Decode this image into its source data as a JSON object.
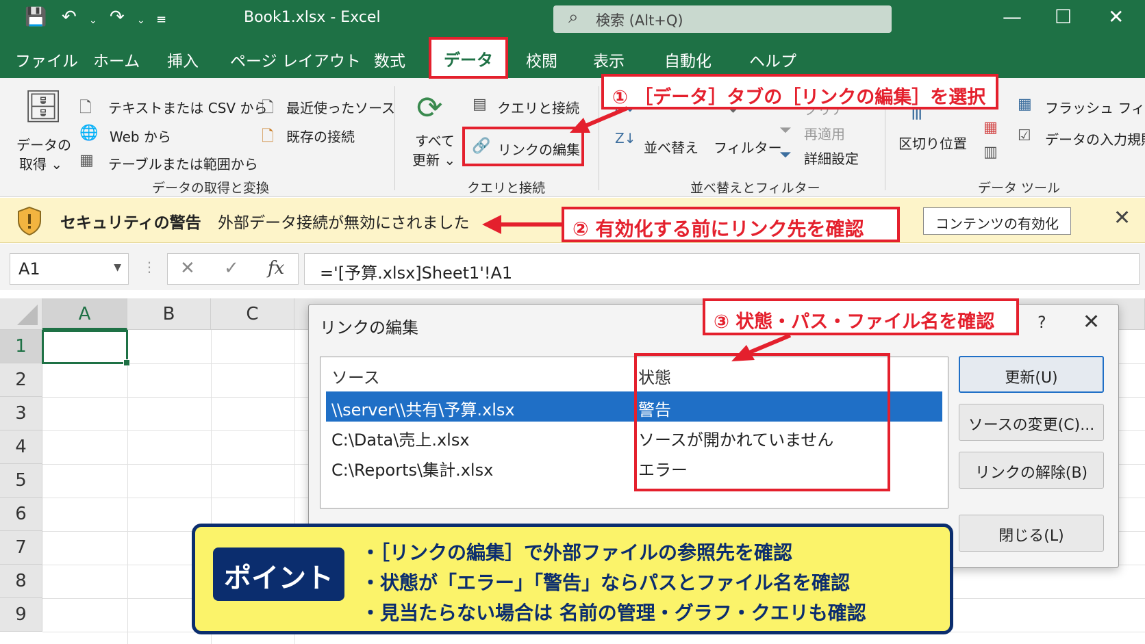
{
  "window": {
    "title": "Book1.xlsx - Excel",
    "search_placeholder": "検索 (Alt+Q)"
  },
  "tabs": [
    "ファイル",
    "ホーム",
    "挿入",
    "ページ レイアウト",
    "数式",
    "データ",
    "校閲",
    "表示",
    "自動化",
    "ヘルプ"
  ],
  "active_tab": "データ",
  "ribbon": {
    "get_data": {
      "label_line1": "データの",
      "label_line2": "取得 ⌄",
      "text_csv": "テキストまたは CSV から",
      "web": "Web から",
      "table_range": "テーブルまたは範囲から",
      "recent_sources": "最近使ったソース",
      "existing_conn": "既存の接続",
      "group": "データの取得と変換"
    },
    "queries": {
      "refresh_line1": "すべて",
      "refresh_line2": "更新 ⌄",
      "queries_conn": "クエリと接続",
      "edit_links": "リンクの編集",
      "group": "クエリと接続"
    },
    "sort_filter": {
      "sort": "並べ替え",
      "filter": "フィルター",
      "clear": "クリア",
      "reapply": "再適用",
      "advanced": "詳細設定",
      "group": "並べ替えとフィルター"
    },
    "data_tools": {
      "text_to_columns": "区切り位置",
      "flash_fill": "フラッシュ フィル",
      "validation": "データの入力規則",
      "group": "データ ツール"
    }
  },
  "callouts": {
    "step1": "① ［データ］タブの［リンクの編集］を選択",
    "step2": "② 有効化する前にリンク先を確認",
    "step3": "③ 状態・パス・ファイル名を確認"
  },
  "security_bar": {
    "title": "セキュリティの警告",
    "message": "外部データ接続が無効にされました",
    "button": "コンテンツの有効化"
  },
  "formula_bar": {
    "name_box": "A1",
    "formula": "='[予算.xlsx]Sheet1'!A1"
  },
  "sheet": {
    "columns": [
      "A",
      "B",
      "C"
    ],
    "rows": [
      "1",
      "2",
      "3",
      "4",
      "5",
      "6",
      "7",
      "8",
      "9"
    ]
  },
  "dialog": {
    "title": "リンクの編集",
    "help": "?",
    "col_source": "ソース",
    "col_status": "状態",
    "links": [
      {
        "source": "\\\\server\\\\共有\\予算.xlsx",
        "status": "警告"
      },
      {
        "source": "C:\\Data\\売上.xlsx",
        "status": "ソースが開かれていません"
      },
      {
        "source": "C:\\Reports\\集計.xlsx",
        "status": "エラー"
      }
    ],
    "buttons": {
      "update": "更新(U)",
      "change_source": "ソースの変更(C)...",
      "break_link": "リンクの解除(B)",
      "close": "閉じる(L)"
    }
  },
  "point": {
    "badge": "ポイント",
    "lines": [
      "・［リンクの編集］で外部ファイルの参照先を確認",
      "・状態が「エラー」「警告」ならパスとファイル名を確認",
      "・見当たらない場合は 名前の管理・グラフ・クエリも確認"
    ]
  },
  "colors": {
    "excel_green": "#1e7145",
    "callout_red": "#e4202d",
    "selection_blue": "#1f6fc6",
    "security_yellow": "#fdf4c9",
    "point_yellow": "#fbf36a",
    "point_navy": "#0b2d6e"
  }
}
